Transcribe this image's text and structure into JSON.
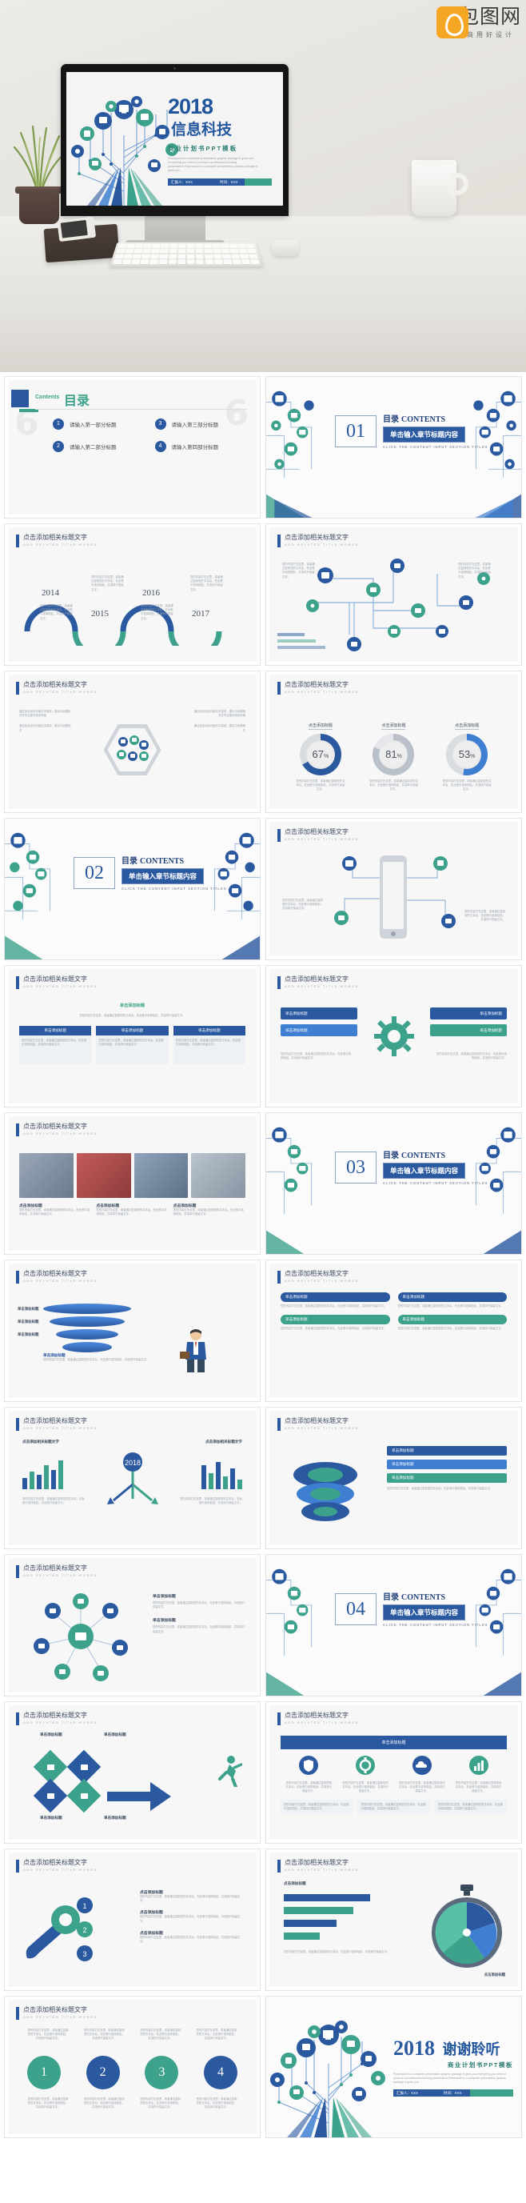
{
  "brand": {
    "logo_cn": "包图网",
    "logo_tagline": "商用好设计",
    "mark_color": "#f5a623",
    "mark_icon": "camera-aperture-icon"
  },
  "colors": {
    "primary_blue": "#2a59a0",
    "light_blue": "#3f7fd1",
    "green": "#3da28c",
    "grey": "#b9c0c9",
    "text_dark": "#3b4a5e",
    "text_muted": "#9aa3ad"
  },
  "hero": {
    "scene_name": "imac-on-desk-mockup",
    "objects": [
      "monitor",
      "keyboard",
      "mouse",
      "notebook",
      "smartphone",
      "potted-plant",
      "coffee-mug"
    ],
    "slide": {
      "year": "2018",
      "title_cn": "信息科技",
      "subtitle": "商业计划书PPT模板",
      "english": "Powerpoint is a complete presentation graphic package.It gives you everything you need to produce a professional-looking presentation.Powerpoint is a complete presentation graphic package.It gives you",
      "footer_presenter": "汇报人：XXX",
      "footer_date": "时间：XXX"
    }
  },
  "common": {
    "slide_header_cn": "点击添加相关标题文字",
    "slide_header_en": "ADD RELATED TITLE WORDS",
    "placeholder_paragraph": "您的内容打在这里，或者通过复制您的文本后，在此框中选择粘贴，并选择只保留文字。",
    "placeholder_title": "单击添加标题",
    "add_title_short": "点击添加标题"
  },
  "slides": [
    {
      "index": 1,
      "type": "contents",
      "label_en": "Contents",
      "label_cn": "目录",
      "items": [
        {
          "no": "1",
          "label": "请输入第一部分标题"
        },
        {
          "no": "3",
          "label": "请输入第三部分标题"
        },
        {
          "no": "2",
          "label": "请输入第二部分标题"
        },
        {
          "no": "4",
          "label": "请输入第四部分标题"
        }
      ]
    },
    {
      "index": 2,
      "type": "section",
      "number": "01",
      "title_cn": "目录",
      "title_en": "CONTENTS",
      "banner": "单击输入章节标题内容",
      "caption": "CLICK THE CONTENT INPUT SECTION TITLES"
    },
    {
      "index": 3,
      "type": "timeline",
      "years": [
        "2014",
        "2015",
        "2016",
        "2017"
      ]
    },
    {
      "index": 4,
      "type": "circuit-diagram",
      "note": "网络科技结构图"
    },
    {
      "index": 5,
      "type": "hexagon-list",
      "left_items": [
        "通过此处添加详细文本描述，建议与标题相关并符合整体语言风格",
        "通过此处添加详细文本描述，建议与标题相关"
      ],
      "right_items": [
        "通过此处添加详细文本描述，建议与标题相关并符合整体语言风格",
        "通过此处添加详细文本描述，建议与标题相关"
      ]
    },
    {
      "index": 6,
      "type": "donuts",
      "items": [
        {
          "title": "点击添加标题",
          "value": 67,
          "unit": "%",
          "color": "#2a59a0"
        },
        {
          "title": "点击添加标题",
          "value": 81,
          "unit": "%",
          "color": "#b9c0c9"
        },
        {
          "title": "点击添加标题",
          "value": 53,
          "unit": "%",
          "color": "#3f7fd1"
        }
      ]
    },
    {
      "index": 7,
      "type": "section",
      "number": "02",
      "title_cn": "目录",
      "title_en": "CONTENTS",
      "banner": "单击输入章节标题内容",
      "caption": "CLICK THE CONTENT INPUT SECTION TITLES"
    },
    {
      "index": 8,
      "type": "device-mockup",
      "note": "手机与设备展示"
    },
    {
      "index": 9,
      "type": "text-cards",
      "cards": [
        "单击添加标题",
        "单击添加标题",
        "单击添加标题"
      ]
    },
    {
      "index": 10,
      "type": "gear-process",
      "steps": [
        "单击添加标题",
        "单击添加标题",
        "单击添加标题",
        "单击添加标题"
      ]
    },
    {
      "index": 11,
      "type": "photo-grid",
      "captions": [
        "点击添加标题",
        "点击添加标题",
        "点击添加标题"
      ]
    },
    {
      "index": 12,
      "type": "section",
      "number": "03",
      "title_cn": "目录",
      "title_en": "CONTENTS",
      "banner": "单击输入章节标题内容",
      "caption": "CLICK THE CONTENT INPUT SECTION TITLES"
    },
    {
      "index": 13,
      "type": "funnel",
      "labels": [
        "单击添加标题",
        "单击添加标题",
        "单击添加标题",
        "单击添加标题"
      ]
    },
    {
      "index": 14,
      "type": "list-bars",
      "rows": [
        "单击添加标题",
        "单击添加标题",
        "单击添加标题",
        "单击添加标题"
      ]
    },
    {
      "index": 15,
      "type": "bar-compare",
      "center_label": "2018",
      "left_title": "点击添加相关标题文字",
      "right_title": "点击添加相关标题文字"
    },
    {
      "index": 16,
      "type": "arrow-steps",
      "steps": [
        "单击添加标题",
        "单击添加标题",
        "单击添加标题"
      ]
    },
    {
      "index": 17,
      "type": "icon-cluster",
      "note": "图标环绕布局"
    },
    {
      "index": 18,
      "type": "section",
      "number": "04",
      "title_cn": "目录",
      "title_en": "CONTENTS",
      "banner": "单击输入章节标题内容",
      "caption": "CLICK THE CONTENT INPUT SECTION TITLES"
    },
    {
      "index": 19,
      "type": "diamond-arrow",
      "labels": [
        "单击添加标题",
        "单击添加标题",
        "单击添加标题",
        "单击添加标题"
      ]
    },
    {
      "index": 20,
      "type": "banner-icons",
      "title": "单击添加标题",
      "count": 4
    },
    {
      "index": 21,
      "type": "steps-list",
      "steps": [
        "1",
        "2",
        "3"
      ]
    },
    {
      "index": 22,
      "type": "bar-pie",
      "bars": [
        72,
        58,
        44,
        30
      ],
      "pie_label": "点击添加标题"
    },
    {
      "index": 23,
      "type": "numbered-circles",
      "numbers": [
        "1",
        "2",
        "3",
        "4"
      ]
    },
    {
      "index": 24,
      "type": "thanks",
      "year": "2018",
      "title_cn": "谢谢聆听",
      "subtitle": "商业计划书PPT模板",
      "english": "Powerpoint is a complete presentation graphic package.It gives you everything you need to produce a professional-looking presentation.Powerpoint is a complete presentation graphic package.It gives you",
      "footer_presenter": "汇报人：XXX",
      "footer_date": "时间：XXX"
    }
  ]
}
